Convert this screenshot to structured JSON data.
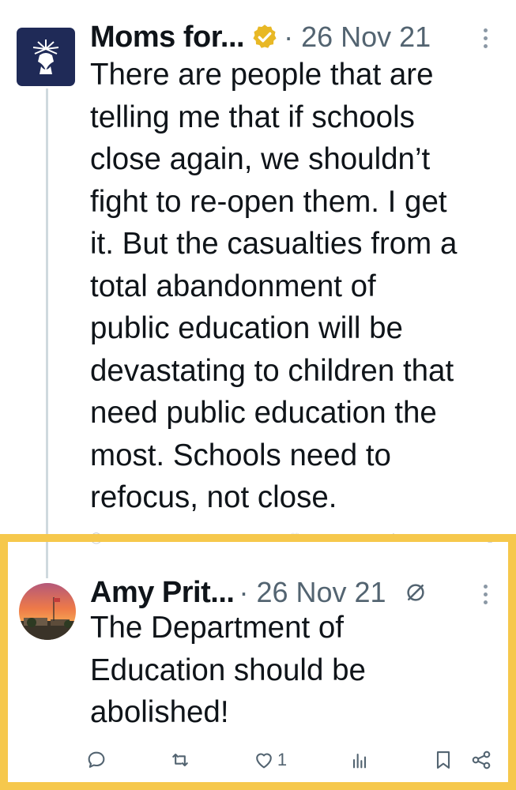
{
  "tweet1": {
    "display_name": "Moms for...",
    "separator": "·",
    "date": "26 Nov 21",
    "avatar_icon": "statue-of-liberty-logo",
    "badge_color": "#e8b825",
    "text": "There are people that are\ntelling me that if schools\nclose again, we shouldn’t\nfight to re-open them. I get\nit. But the casualties from a\ntotal abandonment of\npublic education will be\ndevastating to children that\nneed public education the\nmost. Schools need to\nrefocus, not close."
  },
  "tweet2": {
    "display_name": "Amy Prit...",
    "separator": "·",
    "date": "26 Nov 21",
    "text": "The Department of\nEducation should be\nabolished!",
    "like_count": "1",
    "highlight_color": "#f6c84c"
  }
}
